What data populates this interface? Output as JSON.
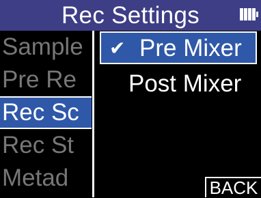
{
  "header": {
    "title": "Rec Settings"
  },
  "status": {
    "battery_icon": "battery-icon"
  },
  "menu": {
    "items": [
      {
        "label": "Sample"
      },
      {
        "label": "Pre Re"
      },
      {
        "label": "Rec Sc"
      },
      {
        "label": "Rec St"
      },
      {
        "label": "Metad"
      }
    ],
    "selected_index": 2
  },
  "options": {
    "items": [
      {
        "label": "Pre Mixer",
        "checked": true
      },
      {
        "label": "Post Mixer",
        "checked": false
      }
    ],
    "check_glyph": "✔"
  },
  "footer": {
    "back_label": "BACK"
  },
  "colors": {
    "header_bg": "#3e3e86",
    "selection_bg": "#2f58a8",
    "dim_text": "#777777"
  }
}
